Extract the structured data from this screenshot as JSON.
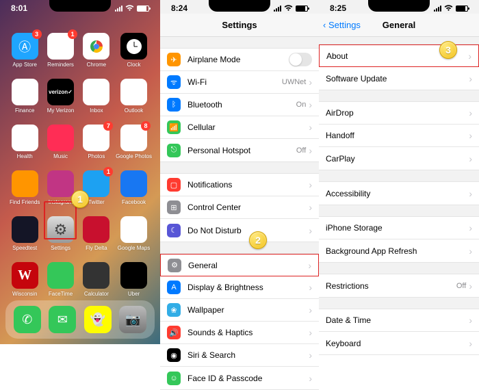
{
  "screen1": {
    "time": "8:01",
    "apps": [
      {
        "label": "App Store",
        "badge": "3",
        "bg": "#1fa5ff"
      },
      {
        "label": "Reminders",
        "badge": "1",
        "bg": "#fff"
      },
      {
        "label": "Chrome",
        "badge": null,
        "bg": "#fff"
      },
      {
        "label": "Clock",
        "badge": null,
        "bg": "#000"
      },
      {
        "label": "Finance",
        "badge": null,
        "bg": "#fff"
      },
      {
        "label": "My Verizon",
        "badge": null,
        "bg": "#000"
      },
      {
        "label": "Inbox",
        "badge": null,
        "bg": "#fff"
      },
      {
        "label": "Outlook",
        "badge": null,
        "bg": "#fff"
      },
      {
        "label": "Health",
        "badge": null,
        "bg": "#fff"
      },
      {
        "label": "Music",
        "badge": null,
        "bg": "#ff2d55"
      },
      {
        "label": "Photos",
        "badge": "7",
        "bg": "#fff"
      },
      {
        "label": "Google Photos",
        "badge": "8",
        "bg": "#fff"
      },
      {
        "label": "Find Friends",
        "badge": null,
        "bg": "#ff9500"
      },
      {
        "label": "Instagram",
        "badge": null,
        "bg": "#c13584"
      },
      {
        "label": "Twitter",
        "badge": "1",
        "bg": "#1da1f2"
      },
      {
        "label": "Facebook",
        "badge": null,
        "bg": "#1877f2"
      },
      {
        "label": "Speedtest",
        "badge": null,
        "bg": "#141526"
      },
      {
        "label": "Settings",
        "badge": null,
        "bg": "#8e8e93"
      },
      {
        "label": "Fly Delta",
        "badge": null,
        "bg": "#c8102e"
      },
      {
        "label": "Google Maps",
        "badge": null,
        "bg": "#fff"
      },
      {
        "label": "Wisconsin",
        "badge": null,
        "bg": "#c5050c"
      },
      {
        "label": "FaceTime",
        "badge": null,
        "bg": "#34c759"
      },
      {
        "label": "Calculator",
        "badge": null,
        "bg": "#333"
      },
      {
        "label": "Uber",
        "badge": null,
        "bg": "#000"
      }
    ],
    "dock": [
      {
        "name": "phone",
        "bg": "#34c759"
      },
      {
        "name": "messages",
        "bg": "#34c759"
      },
      {
        "name": "snapchat",
        "bg": "#fffc00"
      },
      {
        "name": "camera",
        "bg": "#888"
      }
    ],
    "step": "1"
  },
  "screen2": {
    "time": "8:24",
    "title": "Settings",
    "step": "2",
    "groups": [
      [
        {
          "icon": "airplane",
          "color": "c-orange",
          "label": "Airplane Mode",
          "toggle": true
        },
        {
          "icon": "wifi",
          "color": "c-blue",
          "label": "Wi-Fi",
          "value": "UWNet",
          "chev": true
        },
        {
          "icon": "bluetooth",
          "color": "c-blue",
          "label": "Bluetooth",
          "value": "On",
          "chev": true
        },
        {
          "icon": "cellular",
          "color": "c-green",
          "label": "Cellular",
          "chev": true
        },
        {
          "icon": "hotspot",
          "color": "c-green",
          "label": "Personal Hotspot",
          "value": "Off",
          "chev": true
        }
      ],
      [
        {
          "icon": "notifications",
          "color": "c-red",
          "label": "Notifications",
          "chev": true
        },
        {
          "icon": "control",
          "color": "c-gray",
          "label": "Control Center",
          "chev": true
        },
        {
          "icon": "dnd",
          "color": "c-purple",
          "label": "Do Not Disturb",
          "chev": true
        }
      ],
      [
        {
          "icon": "general",
          "color": "c-gray",
          "label": "General",
          "chev": true,
          "highlight": true
        },
        {
          "icon": "display",
          "color": "c-blue",
          "label": "Display & Brightness",
          "chev": true
        },
        {
          "icon": "wallpaper",
          "color": "c-teal",
          "label": "Wallpaper",
          "chev": true
        },
        {
          "icon": "sounds",
          "color": "c-red",
          "label": "Sounds & Haptics",
          "chev": true
        },
        {
          "icon": "siri",
          "color": "c-black",
          "label": "Siri & Search",
          "chev": true
        },
        {
          "icon": "faceid",
          "color": "c-green",
          "label": "Face ID & Passcode",
          "chev": true
        }
      ]
    ]
  },
  "screen3": {
    "time": "8:25",
    "back": "Settings",
    "title": "General",
    "step": "3",
    "groups": [
      [
        {
          "label": "About",
          "chev": true,
          "highlight": true
        },
        {
          "label": "Software Update",
          "chev": true
        }
      ],
      [
        {
          "label": "AirDrop",
          "chev": true
        },
        {
          "label": "Handoff",
          "chev": true
        },
        {
          "label": "CarPlay",
          "chev": true
        }
      ],
      [
        {
          "label": "Accessibility",
          "chev": true
        }
      ],
      [
        {
          "label": "iPhone Storage",
          "chev": true
        },
        {
          "label": "Background App Refresh",
          "chev": true
        }
      ],
      [
        {
          "label": "Restrictions",
          "value": "Off",
          "chev": true
        }
      ],
      [
        {
          "label": "Date & Time",
          "chev": true
        },
        {
          "label": "Keyboard",
          "chev": true
        }
      ]
    ]
  }
}
